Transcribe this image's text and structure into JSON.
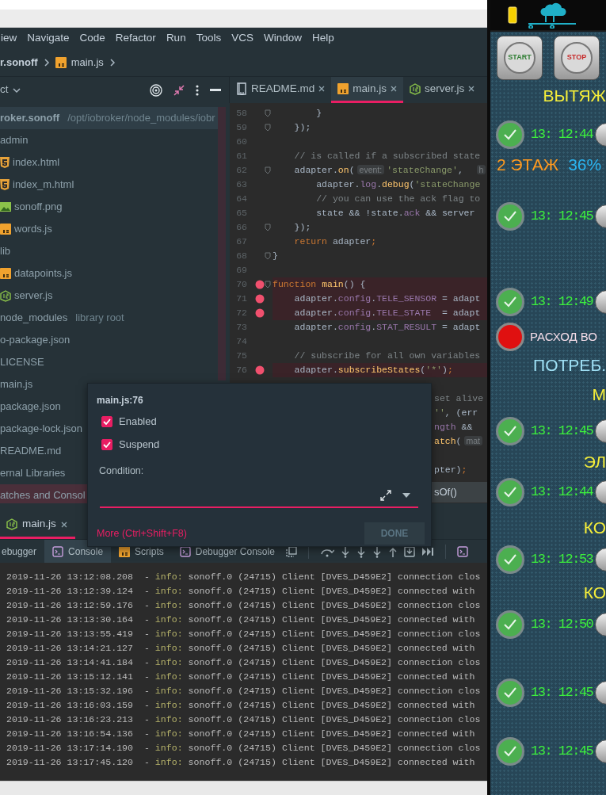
{
  "menu": [
    "iew",
    "Navigate",
    "Code",
    "Refactor",
    "Run",
    "Tools",
    "VCS",
    "Window",
    "Help"
  ],
  "breadcrumb": {
    "project": "r.sonoff",
    "file": "main.js"
  },
  "project": {
    "title": "ct",
    "tree": [
      {
        "label": "roker.sonoff",
        "path": "/opt/iobroker/node_modules/iobr",
        "kind": "root",
        "selected": false,
        "children": [
          {
            "label": "admin",
            "selected": false,
            "children": [
              {
                "label": "index.html",
                "kind": "html",
                "selected": false
              },
              {
                "label": "index_m.html",
                "kind": "html",
                "selected": false
              },
              {
                "label": "sonoff.png",
                "kind": "image",
                "selected": false
              },
              {
                "label": "words.js",
                "kind": "js",
                "selected": false
              }
            ]
          },
          {
            "label": "lib",
            "selected": false,
            "children": [
              {
                "label": "datapoints.js",
                "kind": "js",
                "selected": false
              },
              {
                "label": "server.js",
                "kind": "node",
                "selected": false
              }
            ]
          },
          {
            "label": "node_modules",
            "note": "library root",
            "selected": false
          },
          {
            "label": "o-package.json",
            "selected": false
          },
          {
            "label": "LICENSE",
            "selected": false
          },
          {
            "label": "main.js",
            "selected": false
          },
          {
            "label": "package.json",
            "selected": false
          },
          {
            "label": "package-lock.json",
            "selected": false
          },
          {
            "label": "README.md",
            "selected": false
          }
        ]
      },
      {
        "label": "ernal Libraries",
        "selected": false
      },
      {
        "label": "atches and Consol",
        "selected": true
      }
    ]
  },
  "editor_tabs": [
    {
      "label": "README.md",
      "kind": "markdown",
      "selected": false
    },
    {
      "label": "main.js",
      "kind": "js",
      "selected": true
    },
    {
      "label": "server.js",
      "kind": "node",
      "selected": false
    }
  ],
  "code": {
    "lines": [
      {
        "number": "58",
        "breakpoint": false,
        "fold": true,
        "tokens": [
          {
            "kind": "plain",
            "text": "        }"
          }
        ]
      },
      {
        "number": "59",
        "breakpoint": false,
        "fold": true,
        "tokens": [
          {
            "kind": "plain",
            "text": "    });"
          }
        ]
      },
      {
        "number": "60",
        "breakpoint": false,
        "fold": false
      },
      {
        "number": "61",
        "breakpoint": false,
        "fold": false,
        "tokens": [
          {
            "kind": "comment",
            "text": "    // is called if a subscribed state"
          }
        ]
      },
      {
        "number": "62",
        "breakpoint": false,
        "fold": true,
        "tokens": [
          {
            "kind": "plain",
            "text": "    adapter."
          },
          {
            "kind": "function",
            "text": "on"
          },
          {
            "kind": "plain",
            "text": "("
          },
          {
            "kind": "hint",
            "text": "event:"
          },
          {
            "kind": "string",
            "text": "'stateChange'"
          },
          {
            "kind": "plain",
            "text": ",  "
          },
          {
            "kind": "hint",
            "text": "h"
          }
        ]
      },
      {
        "number": "63",
        "breakpoint": false,
        "fold": false,
        "tokens": [
          {
            "kind": "plain",
            "text": "        adapter."
          },
          {
            "kind": "property",
            "text": "log"
          },
          {
            "kind": "plain",
            "text": "."
          },
          {
            "kind": "function",
            "text": "debug"
          },
          {
            "kind": "plain",
            "text": "("
          },
          {
            "kind": "string",
            "text": "'stateChange"
          }
        ]
      },
      {
        "number": "64",
        "breakpoint": false,
        "fold": false,
        "tokens": [
          {
            "kind": "comment",
            "text": "        // you can use the ack flag to"
          }
        ]
      },
      {
        "number": "65",
        "breakpoint": false,
        "fold": false,
        "tokens": [
          {
            "kind": "plain",
            "text": "        state && !state."
          },
          {
            "kind": "property",
            "text": "ack"
          },
          {
            "kind": "plain",
            "text": " && server"
          }
        ]
      },
      {
        "number": "66",
        "breakpoint": false,
        "fold": true,
        "tokens": [
          {
            "kind": "plain",
            "text": "    });"
          }
        ]
      },
      {
        "number": "67",
        "breakpoint": false,
        "fold": false,
        "tokens": [
          {
            "kind": "keyword",
            "text": "    return"
          },
          {
            "kind": "plain",
            "text": " adapter"
          },
          {
            "kind": "keyword",
            "text": ";"
          }
        ]
      },
      {
        "number": "68",
        "breakpoint": false,
        "fold": true,
        "tokens": [
          {
            "kind": "plain",
            "text": "}"
          }
        ]
      },
      {
        "number": "69",
        "breakpoint": false,
        "fold": false
      },
      {
        "number": "70",
        "breakpoint": true,
        "fold": true,
        "tokens": [
          {
            "kind": "keyword",
            "text": "function "
          },
          {
            "kind": "function",
            "text": "main"
          },
          {
            "kind": "plain",
            "text": "() {"
          }
        ]
      },
      {
        "number": "71",
        "breakpoint": true,
        "fold": false,
        "tokens": [
          {
            "kind": "plain",
            "text": "    adapter."
          },
          {
            "kind": "property",
            "text": "config"
          },
          {
            "kind": "plain",
            "text": "."
          },
          {
            "kind": "property",
            "text": "TELE_SENSOR"
          },
          {
            "kind": "plain",
            "text": " = adapt"
          }
        ]
      },
      {
        "number": "72",
        "breakpoint": true,
        "fold": false,
        "tokens": [
          {
            "kind": "plain",
            "text": "    adapter."
          },
          {
            "kind": "property",
            "text": "config"
          },
          {
            "kind": "plain",
            "text": "."
          },
          {
            "kind": "property",
            "text": "TELE_STATE"
          },
          {
            "kind": "plain",
            "text": "  = adapt"
          }
        ]
      },
      {
        "number": "73",
        "breakpoint": false,
        "fold": false,
        "tokens": [
          {
            "kind": "plain",
            "text": "    adapter."
          },
          {
            "kind": "property",
            "text": "config"
          },
          {
            "kind": "plain",
            "text": "."
          },
          {
            "kind": "property",
            "text": "STAT_RESULT"
          },
          {
            "kind": "plain",
            "text": " = adapt"
          }
        ]
      },
      {
        "number": "74",
        "breakpoint": false,
        "fold": false
      },
      {
        "number": "75",
        "breakpoint": false,
        "fold": false,
        "tokens": [
          {
            "kind": "comment",
            "text": "    // subscribe for all own variables"
          }
        ]
      },
      {
        "number": "76",
        "breakpoint": true,
        "fold": false,
        "tokens": [
          {
            "kind": "plain",
            "text": "    adapter."
          },
          {
            "kind": "function",
            "text": "subscribeStates"
          },
          {
            "kind": "plain",
            "text": "("
          },
          {
            "kind": "string",
            "text": "'*'"
          },
          {
            "kind": "plain",
            "text": ")"
          },
          {
            "kind": "keyword",
            "text": ";"
          }
        ]
      }
    ],
    "partial_lines": [
      {
        "tokens": [
          {
            "kind": "comment",
            "text": "set alive"
          }
        ]
      },
      {
        "tokens": [
          {
            "kind": "string",
            "text": "''"
          },
          {
            "kind": "plain",
            "text": ", (err"
          }
        ]
      },
      {
        "tokens": [
          {
            "kind": "property",
            "text": "ngth"
          },
          {
            "kind": "plain",
            "text": " &&"
          }
        ]
      },
      {
        "tokens": [
          {
            "kind": "function",
            "text": "atch"
          },
          {
            "kind": "plain",
            "text": "("
          },
          {
            "kind": "hint",
            "text": "mat"
          }
        ]
      },
      {
        "tokens": [
          {
            "kind": "plain",
            "text": "pter)"
          },
          {
            "kind": "keyword",
            "text": ";"
          }
        ]
      }
    ],
    "completion": "sOf()"
  },
  "breakpoint_popup": {
    "title": "main.js:76",
    "options": [
      {
        "label": "Enabled",
        "checked": true
      },
      {
        "label": "Suspend",
        "checked": true
      }
    ],
    "condition_label": "Condition:",
    "more_link": "More (Ctrl+Shift+F8)",
    "done": {
      "label": "DONE",
      "disabled": true
    }
  },
  "bottom_tab": {
    "label": "main.js",
    "selected": true
  },
  "debug_tabs": [
    {
      "label": "ebugger",
      "kind": "debugger",
      "selected": false
    },
    {
      "label": "Console",
      "kind": "console",
      "selected": true
    },
    {
      "label": "Scripts",
      "kind": "js",
      "selected": false
    },
    {
      "label": "Debugger Console",
      "kind": "console",
      "selected": false
    }
  ],
  "console": [
    {
      "timestamp": "2019-11-26 13:12:08.208  -",
      "level": "info:",
      "message": "sonoff.0 (24715) Client [DVES_D459E2] connection clos"
    },
    {
      "timestamp": "2019-11-26 13:12:39.124  -",
      "level": "info:",
      "message": "sonoff.0 (24715) Client [DVES_D459E2] connected with"
    },
    {
      "timestamp": "2019-11-26 13:12:59.176  -",
      "level": "info:",
      "message": "sonoff.0 (24715) Client [DVES_D459E2] connection clos"
    },
    {
      "timestamp": "2019-11-26 13:13:30.164  -",
      "level": "info:",
      "message": "sonoff.0 (24715) Client [DVES_D459E2] connected with"
    },
    {
      "timestamp": "2019-11-26 13:13:55.419  -",
      "level": "info:",
      "message": "sonoff.0 (24715) Client [DVES_D459E2] connection clos"
    },
    {
      "timestamp": "2019-11-26 13:14:21.127  -",
      "level": "info:",
      "message": "sonoff.0 (24715) Client [DVES_D459E2] connected with"
    },
    {
      "timestamp": "2019-11-26 13:14:41.184  -",
      "level": "info:",
      "message": "sonoff.0 (24715) Client [DVES_D459E2] connection clos"
    },
    {
      "timestamp": "2019-11-26 13:15:12.141  -",
      "level": "info:",
      "message": "sonoff.0 (24715) Client [DVES_D459E2] connected with"
    },
    {
      "timestamp": "2019-11-26 13:15:32.196  -",
      "level": "info:",
      "message": "sonoff.0 (24715) Client [DVES_D459E2] connection clos"
    },
    {
      "timestamp": "2019-11-26 13:16:03.159  -",
      "level": "info:",
      "message": "sonoff.0 (24715) Client [DVES_D459E2] connected with"
    },
    {
      "timestamp": "2019-11-26 13:16:23.213  -",
      "level": "info:",
      "message": "sonoff.0 (24715) Client [DVES_D459E2] connection clos"
    },
    {
      "timestamp": "2019-11-26 13:16:54.136  -",
      "level": "info:",
      "message": "sonoff.0 (24715) Client [DVES_D459E2] connected with"
    },
    {
      "timestamp": "2019-11-26 13:17:14.190  -",
      "level": "info:",
      "message": "sonoff.0 (24715) Client [DVES_D459E2] connection clos"
    },
    {
      "timestamp": "2019-11-26 13:17:45.120  -",
      "level": "info:",
      "message": "sonoff.0 (24715) Client [DVES_D459E2] connected with"
    }
  ],
  "app": {
    "buttons": [
      {
        "label": "START",
        "color": "#2e7d32"
      },
      {
        "label": "STOP",
        "color": "#c62828"
      }
    ],
    "rows": [
      {
        "kind": "title",
        "text": "ВЫТЯЖ",
        "color": "#f5ee3a"
      },
      {
        "kind": "status",
        "alarm": false,
        "text": "13: 12:44",
        "color": "#3cf03c"
      },
      {
        "kind": "pair",
        "texts": [
          {
            "text": "2 ЭТАЖ",
            "color": "#ff9a1f"
          },
          {
            "text": "36%",
            "color": "#2ab4f0"
          }
        ]
      },
      {
        "kind": "status",
        "alarm": false,
        "text": "13: 12:45",
        "color": "#3cf03c"
      },
      {
        "kind": "status",
        "alarm": false,
        "text": "13: 12:49",
        "color": "#3cf03c"
      },
      {
        "kind": "status",
        "alarm": true,
        "text": "РАСХОД ВО",
        "color": "#f4dce8"
      },
      {
        "kind": "title",
        "text": "ПОТРЕБ.",
        "color": "#9fe0f5"
      },
      {
        "kind": "title",
        "text": "М",
        "color": "#f5ee3a"
      },
      {
        "kind": "status",
        "alarm": false,
        "text": "13: 12:45",
        "color": "#3cf03c"
      },
      {
        "kind": "title",
        "text": "ЭЛ",
        "color": "#f5ee3a"
      },
      {
        "kind": "status",
        "alarm": false,
        "text": "13: 12:44",
        "color": "#3cf03c"
      },
      {
        "kind": "title",
        "text": "КО",
        "color": "#f5ee3a"
      },
      {
        "kind": "status",
        "alarm": false,
        "text": "13: 12:53",
        "color": "#3cf03c"
      },
      {
        "kind": "title",
        "text": "КО",
        "color": "#f5ee3a"
      },
      {
        "kind": "status",
        "alarm": false,
        "text": "13: 12:50",
        "color": "#3cf03c"
      },
      {
        "kind": "status",
        "alarm": false,
        "text": "13: 12:45",
        "color": "#3cf03c"
      },
      {
        "kind": "status",
        "alarm": false,
        "text": "13: 12:45",
        "color": "#3cf03c"
      }
    ]
  }
}
